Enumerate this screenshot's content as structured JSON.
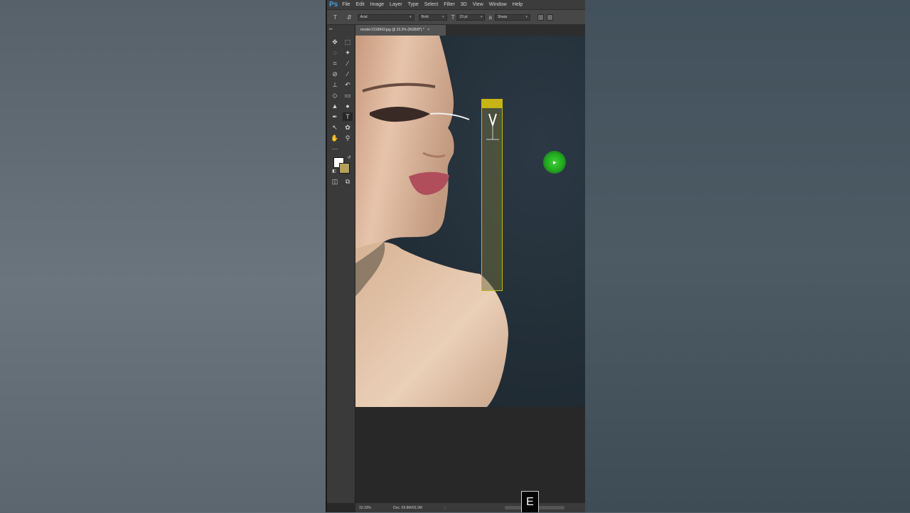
{
  "app": {
    "logo_text": "Ps"
  },
  "menu": [
    "File",
    "Edit",
    "Image",
    "Layer",
    "Type",
    "Select",
    "Filter",
    "3D",
    "View",
    "Window",
    "Help"
  ],
  "options_bar": {
    "font_family": "Arial",
    "font_style": "Bold",
    "font_size": "23 pt",
    "anti_alias": "Sharp"
  },
  "document": {
    "tab_title": "model-2318943.jpg @ 33.3% (RGB/8*) *",
    "close_glyph": "×"
  },
  "status_bar": {
    "zoom": "33.33%",
    "doc_size": "Doc: 69.8M/93.3M"
  },
  "colors": {
    "foreground": "#ffffff",
    "background": "#b6a15a",
    "text_frame_border": "#c9b416",
    "cursor_highlight": "#1fa81c",
    "ps_logo": "#3e9ee6"
  },
  "keystroke_overlay": {
    "key": "E"
  },
  "icons": {
    "type_tool": "type-tool-icon",
    "move_tool": "move-tool-icon",
    "hand_tool": "hand-tool-icon",
    "zoom_tool": "zoom-tool-icon"
  }
}
